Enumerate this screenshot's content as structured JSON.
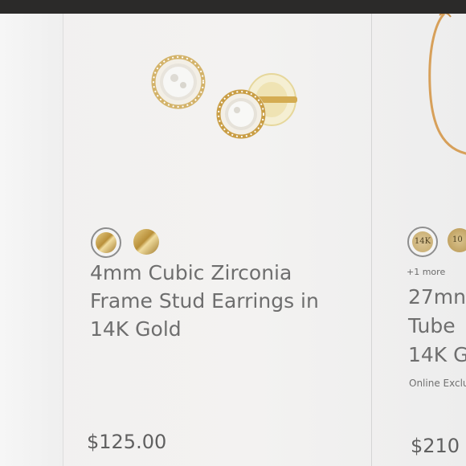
{
  "products": [
    {
      "swatches": [
        {
          "name": "14K Gold",
          "color": "#c9a04a",
          "selected": true
        },
        {
          "name": "Gold",
          "color": "#c9a04a",
          "selected": false
        }
      ],
      "title": "4mm Cubic Zirconia Frame Stud Earrings in 14K Gold",
      "price": "$125.00"
    },
    {
      "swatches": [
        {
          "label": "14K",
          "color": "#d0b678",
          "selected": true
        },
        {
          "label": "10",
          "color": "#c9ab65",
          "selected": false
        }
      ],
      "more": "+1 more",
      "title_lines": [
        "27mn",
        "Tube",
        "14K G"
      ],
      "badge": "Online Exclu",
      "price": "$210"
    }
  ]
}
